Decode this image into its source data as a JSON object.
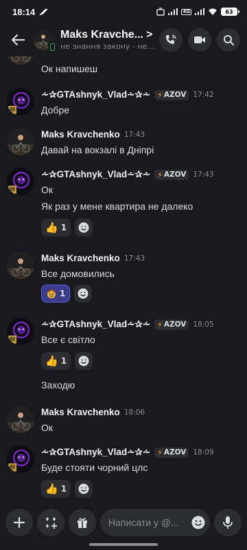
{
  "status_bar": {
    "time": "18:14",
    "net_badge": "4G",
    "battery": "63"
  },
  "header": {
    "title": "Maks Kravche...",
    "chevron": ">",
    "subtitle": "не знання закону - не звіл..."
  },
  "users": {
    "maks": "Maks Kravchenko",
    "gta": "⩪✰GTAshnyk_Vlad⩪✰⩪",
    "gta_tag": "AZOV"
  },
  "messages": [
    {
      "text": "Ок напишеш"
    },
    {
      "user": "gta",
      "time": "17:42",
      "text": "Добре"
    },
    {
      "user": "maks",
      "time": "17:43",
      "text": "Давай на вокзалі в Дніпрі"
    },
    {
      "user": "gta",
      "time": "17:43",
      "text": "Ок",
      "text2": "Як раз у мене квартира не далеко",
      "reaction_count": "1"
    },
    {
      "user": "maks",
      "time": "17:43",
      "text": "Все домовились",
      "reaction_count": "1"
    },
    {
      "user": "gta",
      "time": "18:05",
      "text": "Все є світло",
      "reaction_count": "1",
      "text2": "Заходю"
    },
    {
      "user": "maks",
      "time": "18:06",
      "text": "Ок"
    },
    {
      "user": "gta",
      "time": "18:09",
      "text": "Буде стояти чорний цлс",
      "reaction_count": "1"
    }
  ],
  "input": {
    "placeholder": "Написати у @..."
  },
  "colors": {
    "background": "#1a1a1e",
    "surface": "#2b2d31",
    "accent": "#5865f2",
    "online": "#23a55a",
    "bolt": "#f0b232"
  },
  "icons": {
    "back": "arrow-left-icon",
    "call": "phone-call-icon",
    "video": "video-camera-icon",
    "search": "search-icon",
    "plus": "plus-icon",
    "apps": "apps-icon",
    "gift": "gift-icon",
    "emoji": "emoji-icon",
    "mic": "microphone-icon"
  }
}
